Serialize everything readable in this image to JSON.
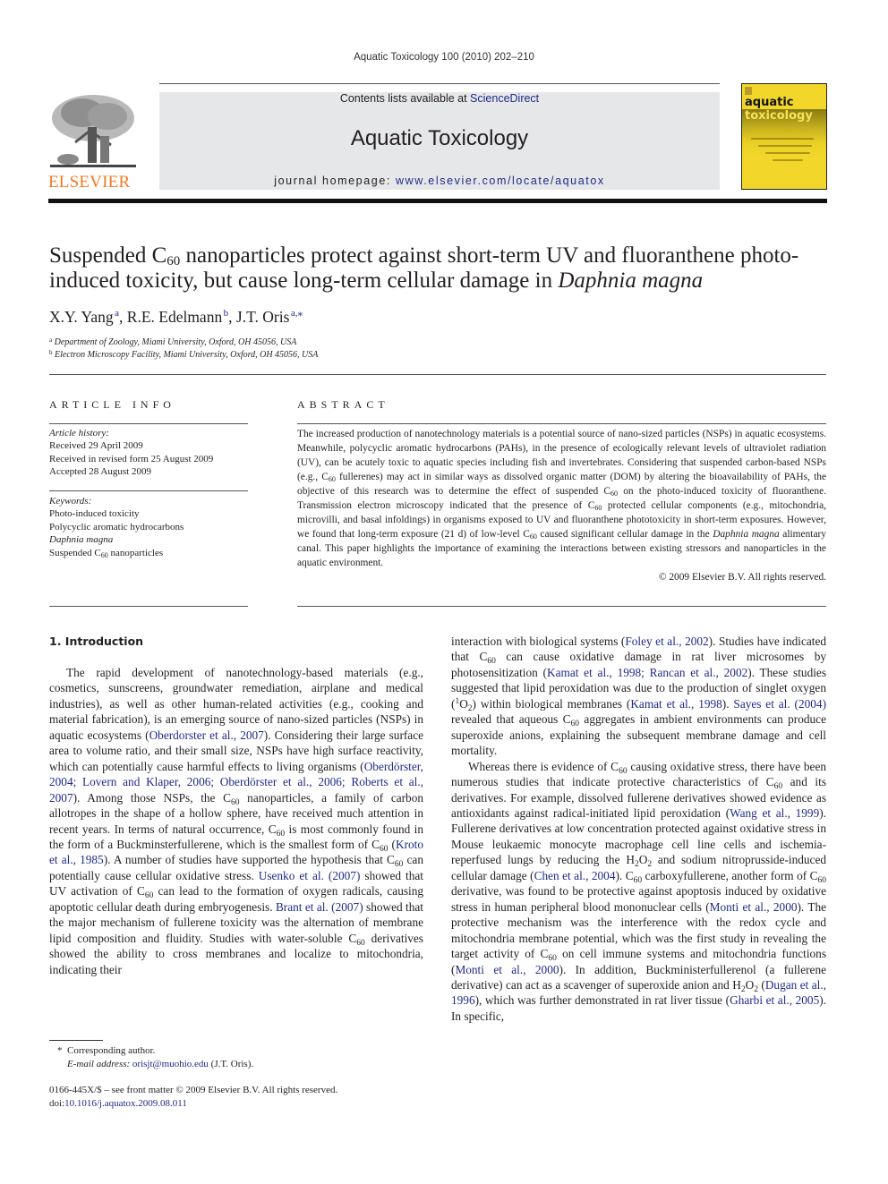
{
  "running_head": "Aquatic Toxicology 100 (2010) 202–210",
  "header": {
    "publisher_logo": "ELSEVIER",
    "contents_prefix": "Contents lists available at ",
    "contents_link": "ScienceDirect",
    "journal_title": "Aquatic Toxicology",
    "homepage_prefix": "journal homepage: ",
    "homepage_link": "www.elsevier.com/locate/aquatox",
    "cover": {
      "line1": "aquatic",
      "line2": "toxicology",
      "color": "#f2d72a"
    }
  },
  "article": {
    "title_part1": "Suspended C",
    "title_sub": "60",
    "title_part2": " nanoparticles protect against short-term UV and fluoranthene photo-induced toxicity, but cause long-term cellular damage in ",
    "title_italic": "Daphnia magna",
    "authors": [
      {
        "name": "X.Y. Yang",
        "sup": "a"
      },
      {
        "name": "R.E. Edelmann",
        "sup": "b"
      },
      {
        "name": "J.T. Oris",
        "sup": "a,⁎"
      }
    ],
    "affiliations": [
      {
        "sup": "a",
        "text": "Department of Zoology, Miami University, Oxford, OH 45056, USA"
      },
      {
        "sup": "b",
        "text": "Electron Microscopy Facility, Miami University, Oxford, OH 45056, USA"
      }
    ]
  },
  "article_info": {
    "heading": "ARTICLE INFO",
    "history_label": "Article history:",
    "history": [
      "Received 29 April 2009",
      "Received in revised form 25 August 2009",
      "Accepted 28 August 2009"
    ],
    "keywords_label": "Keywords:",
    "keywords": [
      "Photo-induced toxicity",
      "Polycyclic aromatic hydrocarbons",
      "Daphnia magna",
      "Suspended C60 nanoparticles"
    ]
  },
  "abstract": {
    "heading": "ABSTRACT",
    "p1": "The increased production of nanotechnology materials is a potential source of nano-sized particles (NSPs) in aquatic ecosystems. Meanwhile, polycyclic aromatic hydrocarbons (PAHs), in the presence of ecologically relevant levels of ultraviolet radiation (UV), can be acutely toxic to aquatic species including fish and invertebrates. Considering that suspended carbon-based NSPs (e.g., C",
    "p2": " fullerenes) may act in similar ways as dissolved organic matter (DOM) by altering the bioavailability of PAHs, the objective of this research was to determine the effect of suspended C",
    "p3": " on the photo-induced toxicity of fluoranthene. Transmission electron microscopy indicated that the presence of C",
    "p4": " protected cellular components (e.g., mitochondria, microvilli, and basal infoldings) in organisms exposed to UV and fluoranthene phototoxicity in short-term exposures. However, we found that long-term exposure (21 d) of low-level C",
    "p5": " caused significant cellular damage in the ",
    "p5_italic": "Daphnia magna",
    "p6": " alimentary canal. This paper highlights the importance of examining the interactions between existing stressors and nanoparticles in the aquatic environment.",
    "copyright": "© 2009 Elsevier B.V. All rights reserved."
  },
  "sub60": "60",
  "introduction": {
    "heading": "1.  Introduction",
    "left": {
      "s1": "The rapid development of nanotechnology-based materials (e.g., cosmetics, sunscreens, groundwater remediation, airplane and medical industries), as well as other human-related activities (e.g., cooking and material fabrication), is an emerging source of nano-sized particles (NSPs) in aquatic ecosystems (",
      "c1": "Oberdorster et al., 2007",
      "s2": "). Considering their large surface area to volume ratio, and their small size, NSPs have high surface reactivity, which can potentially cause harmful effects to living organisms (",
      "c2": "Oberdörster, 2004; Lovern and Klaper, 2006; Oberdörster et al., 2006; Roberts et al., 2007",
      "s3": "). Among those NSPs, the C",
      "s4": " nanoparticles, a family of carbon allotropes in the shape of a hollow sphere, have received much attention in recent years. In terms of natural occurrence, C",
      "s5": " is most commonly found in the form of a Buckminsterfullerene, which is the smallest form of C",
      "s6": " (",
      "c3": "Kroto et al., 1985",
      "s7": "). A number of studies have supported the hypothesis that C",
      "s8": " can potentially cause cellular oxidative stress. ",
      "c4": "Usenko et al. (2007)",
      "s9": " showed that UV activation of C",
      "s10": " can lead to the formation of oxygen radicals, causing apoptotic cellular death during embryogenesis. ",
      "c5": "Brant et al. (2007)",
      "s11": " showed that the major mechanism of fullerene toxicity was the alternation of membrane lipid composition and fluidity. Studies with water-soluble C",
      "s12": " derivatives showed the ability to cross membranes and localize to mitochondria, indicating their"
    },
    "right": {
      "a1": "interaction with biological systems (",
      "ac1": "Foley et al., 2002",
      "a2": "). Studies have indicated that C",
      "a3": " can cause oxidative damage in rat liver microsomes by photosensitization (",
      "ac2": "Kamat et al., 1998; Rancan et al., 2002",
      "a4": "). These studies suggested that lipid peroxidation was due to the production of singlet oxygen (",
      "sup1": "1",
      "o": "O",
      "sub2": "2",
      "a5": ") within biological membranes (",
      "ac3": "Kamat et al., 1998",
      "a6": "). ",
      "ac4": "Sayes et al. (2004)",
      "a7": " revealed that aqueous C",
      "a8": " aggregates in ambient environments can produce superoxide anions, explaining the subsequent membrane damage and cell mortality.",
      "b1": "Whereas there is evidence of C",
      "b2": " causing oxidative stress, there have been numerous studies that indicate protective characteristics of C",
      "b3": " and its derivatives. For example, dissolved fullerene derivatives showed evidence as antioxidants against radical-initiated lipid peroxidation (",
      "bc1": "Wang et al., 1999",
      "b4": "). Fullerene derivatives at low concentration protected against oxidative stress in Mouse leukaemic monocyte macrophage cell line cells and ischemia-reperfused lungs by reducing the H",
      "b5": "O",
      "b6": " and sodium nitroprusside-induced cellular damage (",
      "bc2": "Chen et al., 2004",
      "b7": "). C",
      "b8": " carboxyfullerene, another form of C",
      "b9": " derivative, was found to be protective against apoptosis induced by oxidative stress in human peripheral blood mononuclear cells (",
      "bc3": "Monti et al., 2000",
      "b10": "). The protective mechanism was the interference with the redox cycle and mitochondria membrane potential, which was the first study in revealing the target activity of C",
      "b11": " on cell immune systems and mitochondria functions (",
      "bc4": "Monti et al., 2000",
      "b12": "). In addition, Buckministerfullerenol (a fullerene derivative) can act as a scavenger of superoxide anion and H",
      "b13": "O",
      "b14": " (",
      "bc5": "Dugan et al., 1996",
      "b15": "), which was further demonstrated in rat liver tissue (",
      "bc6": "Gharbi et al., 2005",
      "b16": "). In specific,"
    }
  },
  "footnote": {
    "star": "*",
    "corresponding": "Corresponding author.",
    "email_label": "E-mail address:",
    "email": "orisjt@muohio.edu",
    "email_suffix": " (J.T. Oris)."
  },
  "front_matter": {
    "issn_line": "0166-445X/$ – see front matter © 2009 Elsevier B.V. All rights reserved.",
    "doi_prefix": "doi:",
    "doi": "10.1016/j.aquatox.2009.08.011"
  },
  "colors": {
    "link": "#1f2a8a",
    "elsevier_orange": "#f47920",
    "header_box": "#e6e7e8"
  }
}
